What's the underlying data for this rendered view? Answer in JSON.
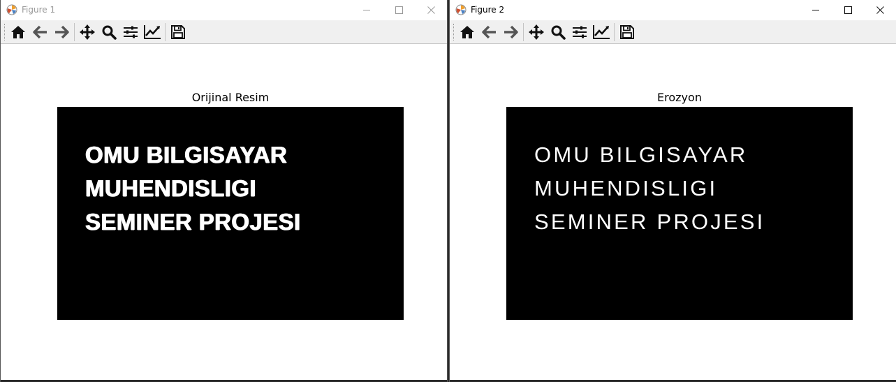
{
  "figures": [
    {
      "window_title": "Figure 1",
      "plot_title": "Orijinal Resim",
      "image_text": [
        "OMU BILGISAYAR",
        "MUHENDISLIGI",
        "SEMINER PROJESI"
      ],
      "image_variant": "original"
    },
    {
      "window_title": "Figure 2",
      "plot_title": "Erozyon",
      "image_text": [
        "OMU BILGISAYAR",
        "MUHENDISLIGI",
        "SEMINER PROJESI"
      ],
      "image_variant": "eroded"
    }
  ],
  "toolbar_icons": [
    "home-icon",
    "back-arrow-icon",
    "forward-arrow-icon",
    "pan-icon",
    "zoom-icon",
    "subplots-icon",
    "axes-edit-icon",
    "save-icon"
  ],
  "colors": {
    "image_background": "#000000",
    "image_text": "#ffffff",
    "toolbar_background": "#f0f0f0",
    "window_background": "#ffffff",
    "inactive_title": "#9a9a9a",
    "icon": "#333333"
  }
}
